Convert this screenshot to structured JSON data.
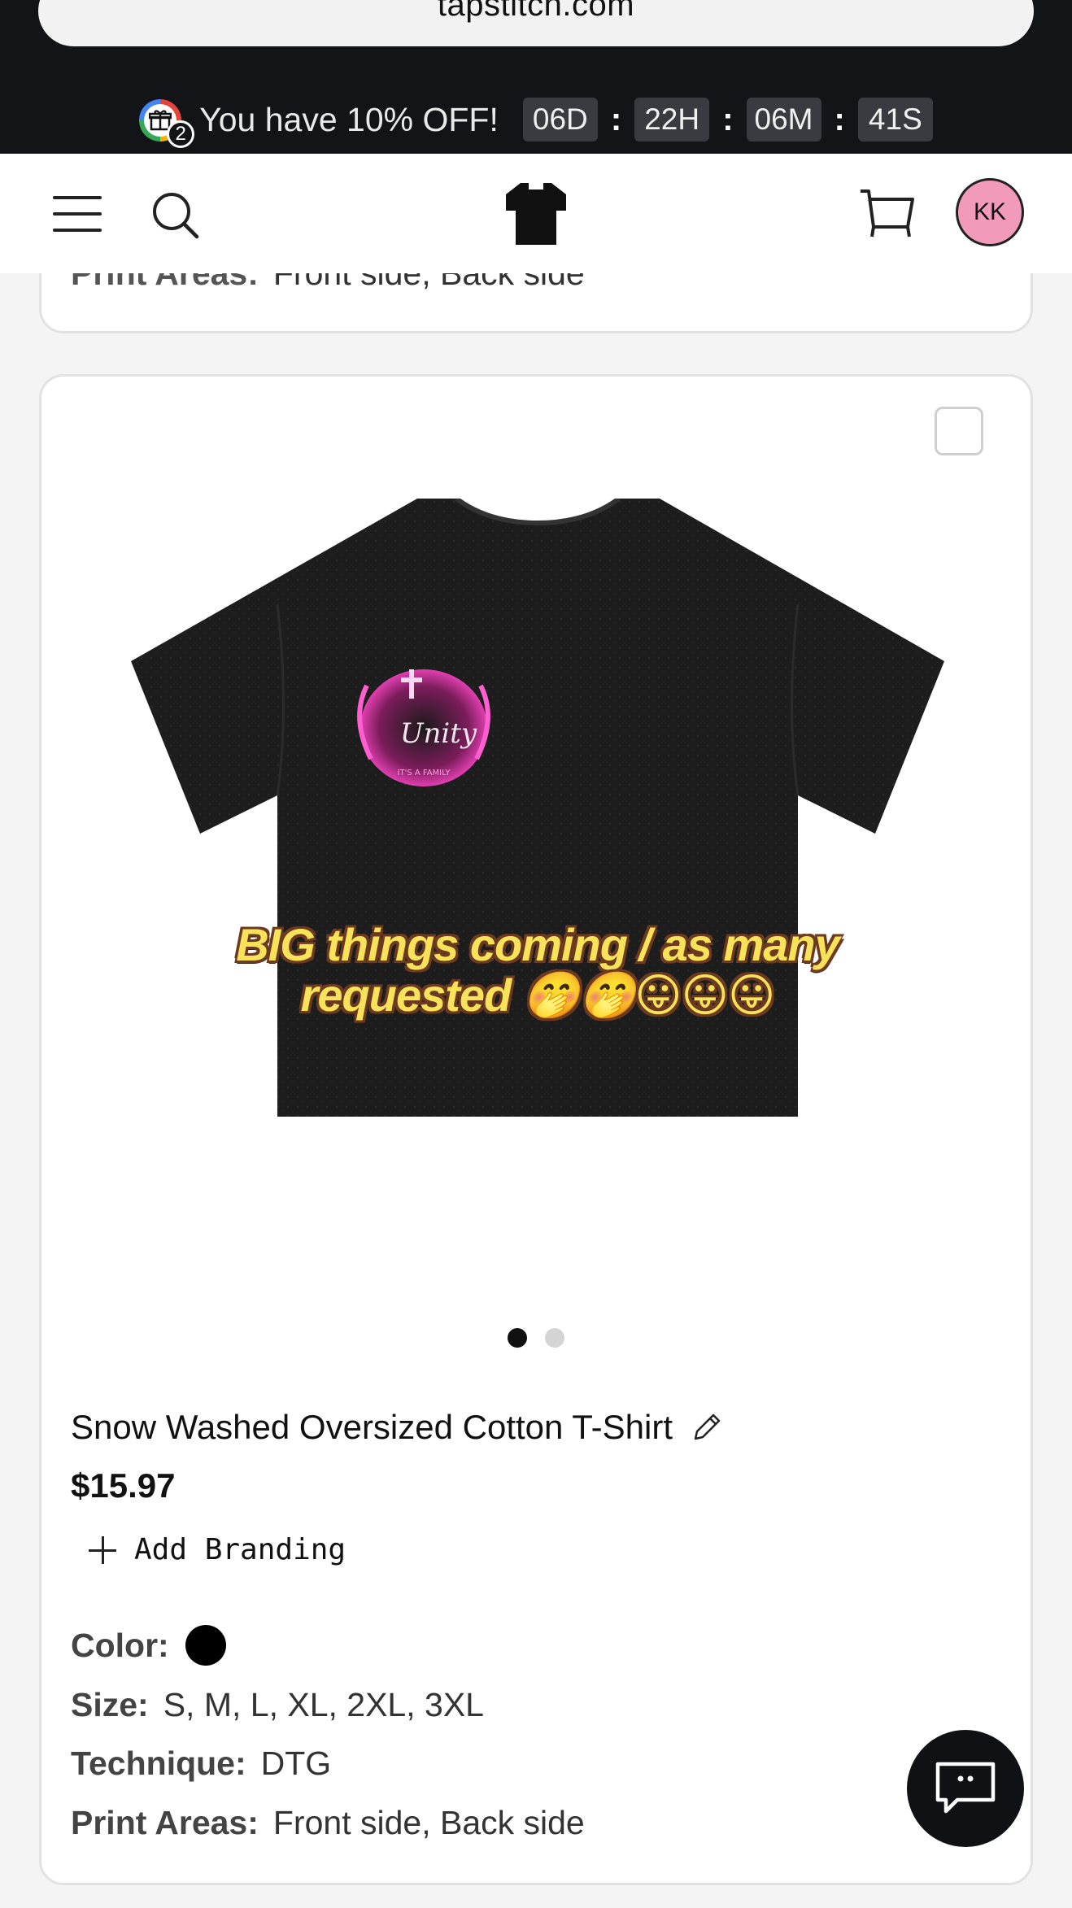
{
  "browser": {
    "url": "tapstitch.com"
  },
  "promo": {
    "gift_count": "2",
    "text": "You have 10% OFF!",
    "timer": {
      "days": "06D",
      "hours": "22H",
      "minutes": "06M",
      "seconds": "41S"
    }
  },
  "header": {
    "avatar_initials": "KK"
  },
  "previous_card": {
    "print_areas_label": "Print Areas:",
    "print_areas_value": "Front side, Back side"
  },
  "product": {
    "overlay_text_line1": "BIG things coming / as many",
    "overlay_text_line2": "requested 🤭🤭😛😛😛",
    "image_count": 2,
    "active_image": 1,
    "title": "Snow Washed Oversized Cotton T-Shirt",
    "price": "$15.97",
    "add_branding_label": "Add Branding",
    "color_label": "Color:",
    "color_value": "#000000",
    "size_label": "Size:",
    "size_value": "S, M, L, XL, 2XL, 3XL",
    "technique_label": "Technique:",
    "technique_value": "DTG",
    "print_areas_label": "Print Areas:",
    "print_areas_value": "Front side, Back side"
  },
  "icons": {
    "menu": "hamburger-icon",
    "search": "search-icon",
    "logo": "tshirt-logo-icon",
    "cart": "cart-icon",
    "edit": "pencil-icon",
    "add": "plus-icon",
    "chat": "chat-icon"
  }
}
